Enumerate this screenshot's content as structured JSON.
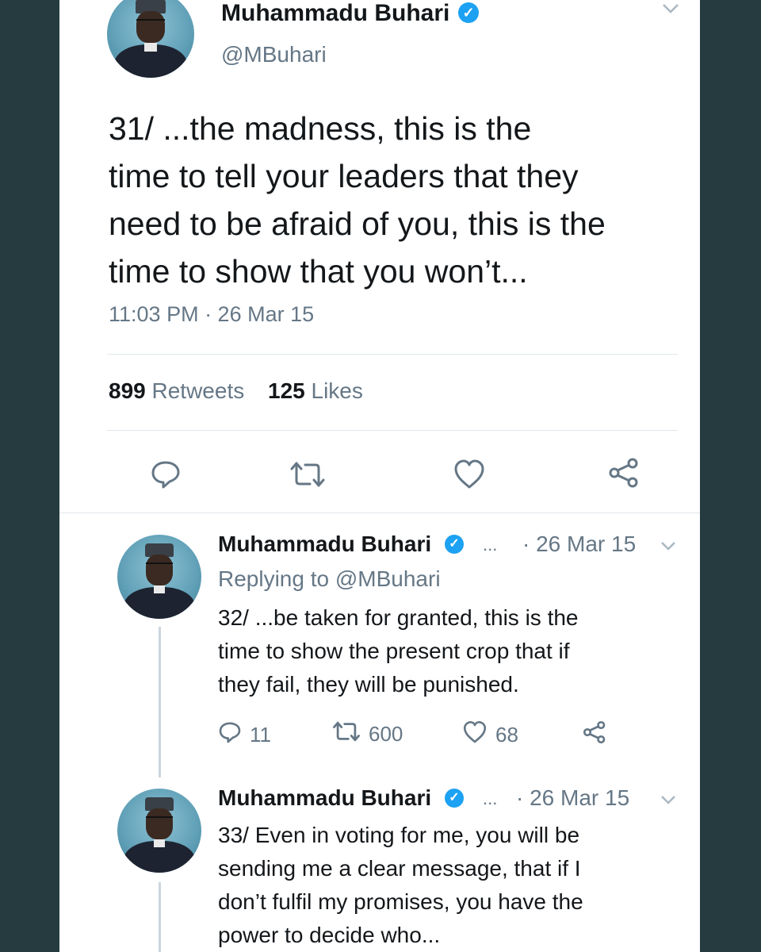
{
  "main_tweet": {
    "name": "Muhammadu Buhari",
    "handle": "@MBuhari",
    "text": "31/ ...the madness, this is the time to tell your leaders that they need to be afraid of you, this is the time to show that you won’t...",
    "line1": "31/ ...the madness, this is the",
    "line2": "time to tell your leaders that they",
    "line3": "need to be afraid of you, this is the",
    "line4": "time to show that you won’t...",
    "timestamp": "11:03 PM · 26 Mar 15",
    "retweets_count": "899",
    "retweets_label": "Retweets",
    "likes_count": "125",
    "likes_label": "Likes",
    "icons": [
      "reply-icon",
      "retweet-icon",
      "like-icon",
      "share-icon"
    ]
  },
  "replies": [
    {
      "name": "Muhammadu Buhari",
      "ellipsis": "...",
      "date": "· 26 Mar 15",
      "replying_to": "Replying to @MBuhari",
      "line1": "32/ ...be taken for granted, this is the",
      "line2": "time to show the present crop that if",
      "line3": "they fail, they will be punished.",
      "reply_count": "11",
      "retweet_count": "600",
      "like_count": "68"
    },
    {
      "name": "Muhammadu Buhari",
      "ellipsis": "...",
      "date": "· 26 Mar 15",
      "line1": "33/ Even in voting for me, you will be",
      "line2": "sending me a clear message, that if I",
      "line3": "don’t fulfil my promises, you have the",
      "line4": "power to decide who..."
    }
  ],
  "colors": {
    "background": "#263b40",
    "card": "#ffffff",
    "verified": "#1da1f2",
    "muted": "#657786",
    "text": "#14171a"
  }
}
